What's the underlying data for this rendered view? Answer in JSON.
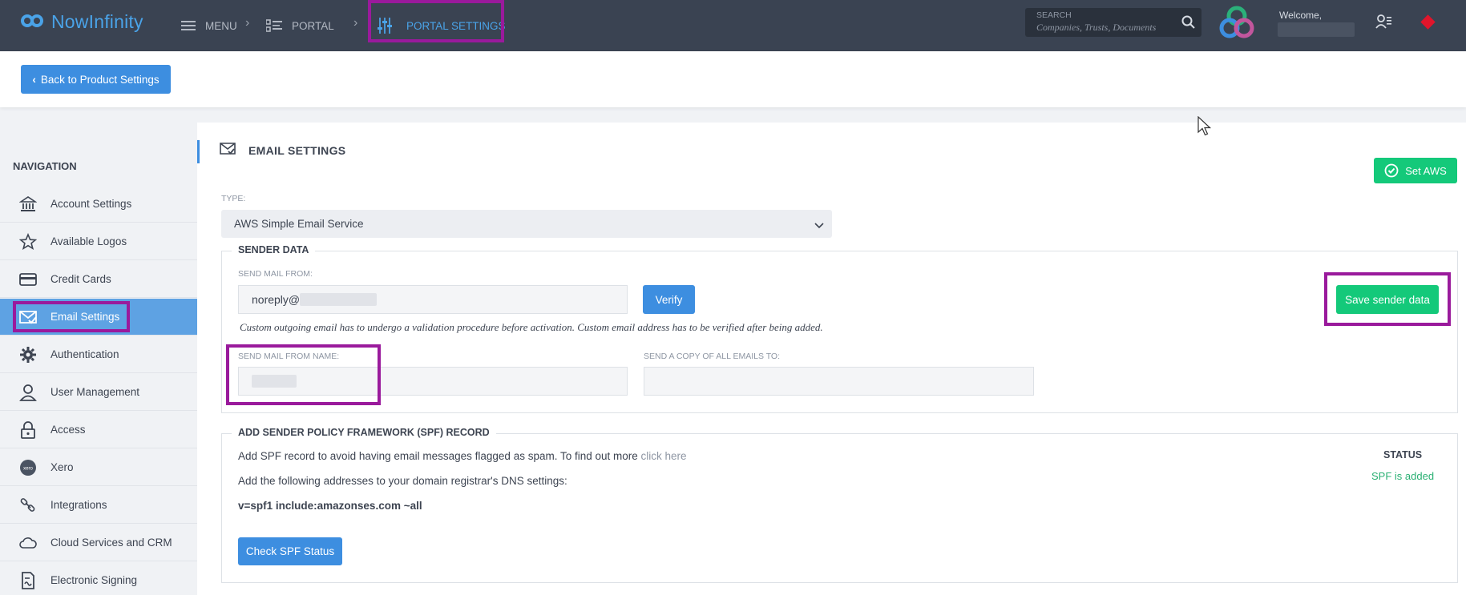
{
  "header": {
    "logo_text": "NowInfinity",
    "breadcrumbs": [
      {
        "label": "MENU"
      },
      {
        "label": "PORTAL"
      },
      {
        "label": "PORTAL SETTINGS"
      }
    ],
    "search": {
      "label": "SEARCH",
      "placeholder": "Companies, Trusts, Documents"
    },
    "welcome": "Welcome,"
  },
  "toolbar": {
    "back_label": "Back to Product Settings"
  },
  "sidebar": {
    "title": "NAVIGATION",
    "items": [
      {
        "label": "Account Settings",
        "icon": "bank-icon"
      },
      {
        "label": "Available Logos",
        "icon": "star-icon"
      },
      {
        "label": "Credit Cards",
        "icon": "credit-card-icon"
      },
      {
        "label": "Email Settings",
        "icon": "email-check-icon",
        "active": true
      },
      {
        "label": "Authentication",
        "icon": "gear-icon"
      },
      {
        "label": "User Management",
        "icon": "user-icon"
      },
      {
        "label": "Access",
        "icon": "lock-icon"
      },
      {
        "label": "Xero",
        "icon": "xero-icon"
      },
      {
        "label": "Integrations",
        "icon": "link-icon"
      },
      {
        "label": "Cloud Services and CRM",
        "icon": "cloud-icon"
      },
      {
        "label": "Electronic Signing",
        "icon": "signing-icon"
      }
    ]
  },
  "email_settings": {
    "title": "EMAIL SETTINGS",
    "set_aws_label": "Set AWS",
    "type_label": "TYPE:",
    "type_value": "AWS Simple Email Service",
    "sender_data": {
      "legend": "SENDER DATA",
      "send_from_label": "SEND MAIL FROM:",
      "send_from_value": "noreply@",
      "verify_label": "Verify",
      "save_label": "Save sender data",
      "note": "Custom outgoing email has to undergo a validation procedure before activation. Custom email address has to be verified after being added.",
      "from_name_label": "SEND MAIL FROM NAME:",
      "copy_to_label": "SEND A COPY OF ALL EMAILS TO:",
      "copy_to_value": ""
    },
    "spf": {
      "legend": "ADD SENDER POLICY FRAMEWORK (SPF) RECORD",
      "line1": "Add SPF record to avoid having email messages flagged as spam. To find out more",
      "link": "click here",
      "line2": "Add the following addresses to your domain registrar's DNS settings:",
      "record": "v=spf1 include:amazonses.com ~all",
      "check_label": "Check SPF Status",
      "status_label": "STATUS",
      "status_value": "SPF is added"
    }
  },
  "colors": {
    "topbar": "#3a4352",
    "accent_blue": "#3d8ee0",
    "accent_green": "#14c97a",
    "highlight": "#9a1a9c",
    "status_green": "#2ab073"
  }
}
